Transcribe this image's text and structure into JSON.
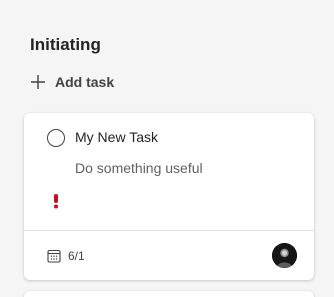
{
  "column": {
    "title": "Initiating",
    "add_task_label": "Add task"
  },
  "task": {
    "title": "My New Task",
    "notes": "Do something useful",
    "priority": "important",
    "priority_color": "#c50f1f",
    "due_date": "6/1",
    "assignee_icon": "avatar"
  }
}
